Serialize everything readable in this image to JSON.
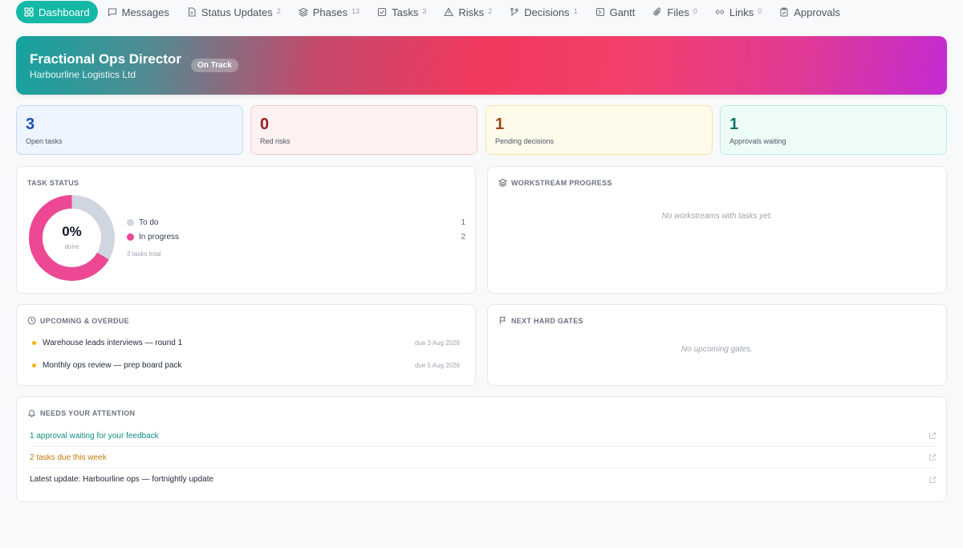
{
  "tabs": [
    {
      "label": "Dashboard",
      "icon": "grid-icon",
      "count": ""
    },
    {
      "label": "Messages",
      "icon": "chat-icon",
      "count": ""
    },
    {
      "label": "Status Updates",
      "icon": "document-icon",
      "count": "2"
    },
    {
      "label": "Phases",
      "icon": "layers-icon",
      "count": "13"
    },
    {
      "label": "Tasks",
      "icon": "checkbox-icon",
      "count": "3"
    },
    {
      "label": "Risks",
      "icon": "warning-icon",
      "count": "2"
    },
    {
      "label": "Decisions",
      "icon": "branch-icon",
      "count": "1"
    },
    {
      "label": "Gantt",
      "icon": "gantt-icon",
      "count": ""
    },
    {
      "label": "Files",
      "icon": "paperclip-icon",
      "count": "0"
    },
    {
      "label": "Links",
      "icon": "link-icon",
      "count": "0"
    },
    {
      "label": "Approvals",
      "icon": "clipboard-icon",
      "count": ""
    }
  ],
  "banner": {
    "title": "Fractional Ops Director",
    "client": "Harbourline Logistics Ltd",
    "status": "On Track"
  },
  "stats": [
    {
      "value": "3",
      "label": "Open tasks",
      "color": "#1e4eb2"
    },
    {
      "value": "0",
      "label": "Red risks",
      "color": "#9b1c1c"
    },
    {
      "value": "1",
      "label": "Pending decisions",
      "color": "#a0461d"
    },
    {
      "value": "1",
      "label": "Approvals waiting",
      "color": "#0f766e"
    }
  ],
  "task_status": {
    "title": "TASK STATUS",
    "percent_done": "0%",
    "done_label": "done",
    "legend": [
      {
        "label": "To do",
        "value": 1,
        "color": "#cfd6df"
      },
      {
        "label": "In progress",
        "value": 2,
        "color": "#ec4893"
      }
    ],
    "total_text": "3 tasks total"
  },
  "workstream": {
    "title": "WORKSTREAM PROGRESS",
    "empty": "No workstreams with tasks yet."
  },
  "upcoming": {
    "title": "UPCOMING & OVERDUE",
    "items": [
      {
        "label": "Warehouse leads interviews — round 1",
        "due": "due 3 Aug 2026"
      },
      {
        "label": "Monthly ops review — prep board pack",
        "due": "due 5 Aug 2026"
      }
    ]
  },
  "gates": {
    "title": "NEXT HARD GATES",
    "empty": "No upcoming gates."
  },
  "attention": {
    "title": "NEEDS YOUR ATTENTION",
    "items": [
      {
        "label": "1 approval waiting for your feedback",
        "color": "#0f8f82"
      },
      {
        "label": "2 tasks due this week",
        "color": "#c27a0e"
      },
      {
        "label": "Latest update: Harbourline ops — fortnightly update",
        "color": "#1f2937"
      }
    ]
  }
}
